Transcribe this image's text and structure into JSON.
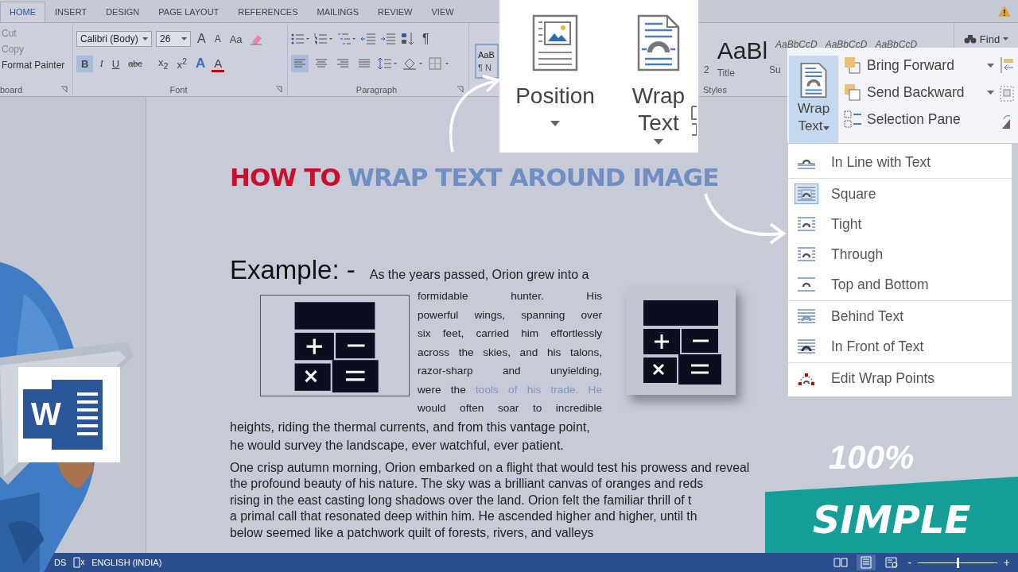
{
  "ribbon_tabs": [
    {
      "label": "HOME",
      "selected": true
    },
    {
      "label": "INSERT",
      "selected": false
    },
    {
      "label": "DESIGN",
      "selected": false
    },
    {
      "label": "PAGE LAYOUT",
      "selected": false
    },
    {
      "label": "REFERENCES",
      "selected": false
    },
    {
      "label": "MAILINGS",
      "selected": false
    },
    {
      "label": "REVIEW",
      "selected": false
    },
    {
      "label": "VIEW",
      "selected": false
    }
  ],
  "clipboard": {
    "items": [
      {
        "label": "Cut",
        "disabled": true
      },
      {
        "label": "Copy",
        "disabled": true
      },
      {
        "label": "Format Painter",
        "disabled": false
      }
    ],
    "group_label": "board"
  },
  "font": {
    "family": "Calibri (Body)",
    "size": "26",
    "group_label": "Font",
    "row1": [
      {
        "label": "A",
        "kind": "grow"
      },
      {
        "label": "A",
        "kind": "shrink"
      },
      {
        "label": "Aa",
        "kind": "case"
      }
    ],
    "row2": [
      {
        "label": "B",
        "kind": "bold",
        "selected": true
      },
      {
        "label": "I",
        "kind": "italic",
        "selected": false
      },
      {
        "label": "U",
        "kind": "underline",
        "selected": false
      },
      {
        "label": "abc",
        "kind": "strike",
        "selected": false
      },
      {
        "label": "x$_{2}$",
        "kind": "sub",
        "selected": false
      },
      {
        "label": "x$^{2}$",
        "kind": "sup",
        "selected": false
      },
      {
        "label": "A",
        "kind": "effects",
        "selected": false
      },
      {
        "label": "A",
        "kind": "color",
        "selected": false
      }
    ]
  },
  "paragraph": {
    "group_label": "Paragraph",
    "marks": "¶",
    "align": [
      {
        "kind": "left",
        "selected": true
      },
      {
        "kind": "center",
        "selected": false
      },
      {
        "kind": "right",
        "selected": false
      },
      {
        "kind": "justify",
        "selected": false
      }
    ]
  },
  "styles": {
    "group_label": "Styles",
    "items": [
      {
        "sample": "AaB",
        "name": "¶ N"
      },
      {
        "name": "2"
      },
      {
        "sample": "AaBl",
        "name": "Title"
      },
      {
        "name": "Su"
      }
    ],
    "small_samples": [
      "AaBbCcD",
      "AaBbCcD",
      "AaBbCcD"
    ]
  },
  "editing": {
    "find": "Find"
  },
  "zoom_popup": {
    "buttons": [
      {
        "label": "Position",
        "kind": "position"
      },
      {
        "label": "Wrap Text",
        "kind": "wrap"
      }
    ]
  },
  "arrange_panel": {
    "wrap_button": {
      "label": "Wrap Text",
      "selected": true
    },
    "commands": [
      {
        "label": "Bring Forward",
        "kind": "forward"
      },
      {
        "label": "Send Backward",
        "kind": "backward"
      },
      {
        "label": "Selection Pane",
        "kind": "pane"
      }
    ]
  },
  "wrap_menu": {
    "sections": [
      [
        {
          "label": "In Line with Text",
          "kind": "inline",
          "selected": false
        }
      ],
      [
        {
          "label": "Square",
          "kind": "square",
          "selected": true
        },
        {
          "label": "Tight",
          "kind": "tight",
          "selected": false
        },
        {
          "label": "Through",
          "kind": "through",
          "selected": false
        },
        {
          "label": "Top and Bottom",
          "kind": "topbottom",
          "selected": false
        }
      ],
      [
        {
          "label": "Behind Text",
          "kind": "behind",
          "selected": false
        },
        {
          "label": "In Front of Text",
          "kind": "front",
          "selected": false
        }
      ],
      [
        {
          "label": "Edit Wrap Points",
          "kind": "points",
          "selected": false
        }
      ]
    ]
  },
  "document": {
    "title": [
      {
        "text": "HOW TO",
        "color": "#c8102e"
      },
      {
        "text": "WRAP TEXT AROUND IMAGE",
        "color": "#6f8fc4"
      }
    ],
    "heading": "Example: -",
    "first_line": "As the years passed, Orion grew into a",
    "wrapped_lines": [
      {
        "text": "formidable hunter. His"
      },
      {
        "text": "powerful wings, spanning over"
      },
      {
        "text": "six feet, carried him effortlessly"
      },
      {
        "text": "across the skies, and his talons,"
      },
      {
        "text": "razor-sharp and unyielding,"
      },
      {
        "text": "were the",
        "link": "tools of his trade. He"
      },
      {
        "text": "would often soar to incredible"
      }
    ],
    "full_lines": [
      "heights, riding the thermal currents, and from this vantage point,",
      "he would survey the landscape, ever watchful, ever patient."
    ],
    "paragraph2": [
      "One crisp autumn morning, Orion embarked on a flight that would test his prowess and reveal",
      "the profound beauty of his nature. The sky was a brilliant canvas of oranges and reds",
      "rising in the east casting long shadows over the land. Orion felt the familiar thrill of t",
      "a primal call that resonated deep within him. He ascended higher and higher, until th",
      "below seemed like a patchwork quilt of forests, rivers, and valleys"
    ]
  },
  "logo": {
    "letter": "W"
  },
  "promo": {
    "percent": "100%",
    "word": "SIMPLE"
  },
  "status_bar": {
    "words": "DS",
    "language": "ENGLISH (INDIA)",
    "zoom_out": "-",
    "zoom_in": "+",
    "zoom": {
      "level": 0.5
    },
    "views": [
      {
        "kind": "read",
        "selected": false
      },
      {
        "kind": "print",
        "selected": true
      },
      {
        "kind": "web",
        "selected": false
      }
    ]
  }
}
